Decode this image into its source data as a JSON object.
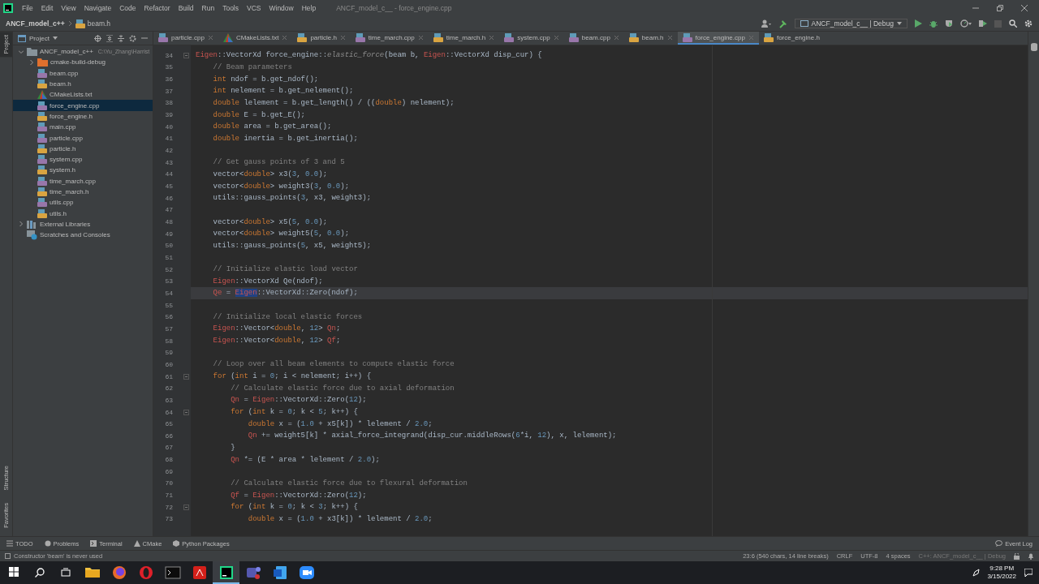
{
  "menu": [
    "File",
    "Edit",
    "View",
    "Navigate",
    "Code",
    "Refactor",
    "Build",
    "Run",
    "Tools",
    "VCS",
    "Window",
    "Help"
  ],
  "window": {
    "title": "ANCF_model_c__ - force_engine.cpp"
  },
  "breadcrumb": [
    "ANCF_model_c++",
    "beam.h"
  ],
  "run_config": "ANCF_model_c__ | Debug",
  "side_tools": {
    "top": [
      "Project"
    ],
    "bottom": [
      "Structure",
      "Favorites"
    ]
  },
  "project": {
    "title": "Project",
    "tree": [
      {
        "label": "ANCF_model_c++",
        "path": "C:\\Yu_Zhang\\Harrist",
        "kind": "module",
        "expanded": true,
        "selected": false,
        "children": [
          {
            "label": "cmake-build-debug",
            "kind": "folder",
            "expanded": false,
            "selected": false
          },
          {
            "label": "beam.cpp",
            "kind": "cpp",
            "selected": false
          },
          {
            "label": "beam.h",
            "kind": "h",
            "selected": false
          },
          {
            "label": "CMakeLists.txt",
            "kind": "cmake",
            "selected": false
          },
          {
            "label": "force_engine.cpp",
            "kind": "cpp",
            "selected": true
          },
          {
            "label": "force_engine.h",
            "kind": "h",
            "selected": false
          },
          {
            "label": "main.cpp",
            "kind": "cpp",
            "selected": false
          },
          {
            "label": "particle.cpp",
            "kind": "cpp",
            "selected": false
          },
          {
            "label": "particle.h",
            "kind": "h",
            "selected": false
          },
          {
            "label": "system.cpp",
            "kind": "cpp",
            "selected": false
          },
          {
            "label": "system.h",
            "kind": "h",
            "selected": false
          },
          {
            "label": "time_march.cpp",
            "kind": "cpp",
            "selected": false
          },
          {
            "label": "time_march.h",
            "kind": "h",
            "selected": false
          },
          {
            "label": "utils.cpp",
            "kind": "cpp",
            "selected": false
          },
          {
            "label": "utils.h",
            "kind": "h",
            "selected": false
          }
        ]
      },
      {
        "label": "External Libraries",
        "kind": "libs",
        "expanded": false,
        "selected": false
      },
      {
        "label": "Scratches and Consoles",
        "kind": "scratches",
        "selected": false
      }
    ]
  },
  "tabs": [
    {
      "label": "particle.cpp",
      "kind": "cpp",
      "selected": false,
      "closable": true
    },
    {
      "label": "CMakeLists.txt",
      "kind": "cmake",
      "selected": false,
      "closable": true
    },
    {
      "label": "particle.h",
      "kind": "h",
      "selected": false,
      "closable": true
    },
    {
      "label": "time_march.cpp",
      "kind": "cpp",
      "selected": false,
      "closable": true
    },
    {
      "label": "time_march.h",
      "kind": "h",
      "selected": false,
      "closable": true
    },
    {
      "label": "system.cpp",
      "kind": "cpp",
      "selected": false,
      "closable": true
    },
    {
      "label": "beam.cpp",
      "kind": "cpp",
      "selected": false,
      "closable": true
    },
    {
      "label": "beam.h",
      "kind": "h",
      "selected": false,
      "closable": true
    },
    {
      "label": "force_engine.cpp",
      "kind": "cpp",
      "selected": true,
      "closable": true
    },
    {
      "label": "force_engine.h",
      "kind": "h",
      "selected": false,
      "closable": false
    }
  ],
  "code": {
    "lines": [
      {
        "number": "34",
        "current": false,
        "segments": [
          {
            "kind": "red",
            "text": "Eigen"
          },
          {
            "kind": "plain",
            "text": "::VectorXd force_engine::"
          },
          {
            "kind": "decl",
            "text": "elastic_force"
          },
          {
            "kind": "plain",
            "text": "(beam b, "
          },
          {
            "kind": "red",
            "text": "Eigen"
          },
          {
            "kind": "plain",
            "text": "::VectorXd disp_cur) {"
          }
        ],
        "children": [
          {
            "number": "35",
            "current": false,
            "segments": [
              {
                "kind": "comment",
                "text": "// Beam parameters"
              }
            ]
          },
          {
            "number": "36",
            "current": false,
            "segments": [
              {
                "kind": "keyword",
                "text": "int"
              },
              {
                "kind": "plain",
                "text": " ndof = b.get_ndof();"
              }
            ]
          },
          {
            "number": "37",
            "current": false,
            "segments": [
              {
                "kind": "keyword",
                "text": "int"
              },
              {
                "kind": "plain",
                "text": " nelement = b.get_nelement();"
              }
            ]
          },
          {
            "number": "38",
            "current": false,
            "segments": [
              {
                "kind": "keyword",
                "text": "double"
              },
              {
                "kind": "plain",
                "text": " lelement = b.get_length() / (("
              },
              {
                "kind": "keyword",
                "text": "double"
              },
              {
                "kind": "plain",
                "text": ") nelement);"
              }
            ]
          },
          {
            "number": "39",
            "current": false,
            "segments": [
              {
                "kind": "keyword",
                "text": "double"
              },
              {
                "kind": "plain",
                "text": " E = b.get_E();"
              }
            ]
          },
          {
            "number": "40",
            "current": false,
            "segments": [
              {
                "kind": "keyword",
                "text": "double"
              },
              {
                "kind": "plain",
                "text": " area = b.get_area();"
              }
            ]
          },
          {
            "number": "41",
            "current": false,
            "segments": [
              {
                "kind": "keyword",
                "text": "double"
              },
              {
                "kind": "plain",
                "text": " inertia = b.get_inertia();"
              }
            ]
          },
          {
            "number": "42",
            "current": false
          },
          {
            "number": "43",
            "current": false,
            "segments": [
              {
                "kind": "comment",
                "text": "// Get gauss points of 3 and 5"
              }
            ]
          },
          {
            "number": "44",
            "current": false,
            "segments": [
              {
                "kind": "plain",
                "text": "vector<"
              },
              {
                "kind": "keyword",
                "text": "double"
              },
              {
                "kind": "plain",
                "text": "> x3("
              },
              {
                "kind": "number",
                "text": "3"
              },
              {
                "kind": "plain",
                "text": ", "
              },
              {
                "kind": "number",
                "text": "0.0"
              },
              {
                "kind": "plain",
                "text": ");"
              }
            ]
          },
          {
            "number": "45",
            "current": false,
            "segments": [
              {
                "kind": "plain",
                "text": "vector<"
              },
              {
                "kind": "keyword",
                "text": "double"
              },
              {
                "kind": "plain",
                "text": "> weight3("
              },
              {
                "kind": "number",
                "text": "3"
              },
              {
                "kind": "plain",
                "text": ", "
              },
              {
                "kind": "number",
                "text": "0.0"
              },
              {
                "kind": "plain",
                "text": ");"
              }
            ]
          },
          {
            "number": "46",
            "current": false,
            "segments": [
              {
                "kind": "plain",
                "text": "utils::gauss_points("
              },
              {
                "kind": "number",
                "text": "3"
              },
              {
                "kind": "plain",
                "text": ", x3, weight3);"
              }
            ]
          },
          {
            "number": "47",
            "current": false
          },
          {
            "number": "48",
            "current": false,
            "segments": [
              {
                "kind": "plain",
                "text": "vector<"
              },
              {
                "kind": "keyword",
                "text": "double"
              },
              {
                "kind": "plain",
                "text": "> x5("
              },
              {
                "kind": "number",
                "text": "5"
              },
              {
                "kind": "plain",
                "text": ", "
              },
              {
                "kind": "number",
                "text": "0.0"
              },
              {
                "kind": "plain",
                "text": ");"
              }
            ]
          },
          {
            "number": "49",
            "current": false,
            "segments": [
              {
                "kind": "plain",
                "text": "vector<"
              },
              {
                "kind": "keyword",
                "text": "double"
              },
              {
                "kind": "plain",
                "text": "> weight5("
              },
              {
                "kind": "number",
                "text": "5"
              },
              {
                "kind": "plain",
                "text": ", "
              },
              {
                "kind": "number",
                "text": "0.0"
              },
              {
                "kind": "plain",
                "text": ");"
              }
            ]
          },
          {
            "number": "50",
            "current": false,
            "segments": [
              {
                "kind": "plain",
                "text": "utils::gauss_points("
              },
              {
                "kind": "number",
                "text": "5"
              },
              {
                "kind": "plain",
                "text": ", x5, weight5);"
              }
            ]
          },
          {
            "number": "51",
            "current": false
          },
          {
            "number": "52",
            "current": false,
            "segments": [
              {
                "kind": "comment",
                "text": "// Initialize elastic load vector"
              }
            ]
          },
          {
            "number": "53",
            "current": false,
            "segments": [
              {
                "kind": "red",
                "text": "Eigen"
              },
              {
                "kind": "plain",
                "text": "::VectorXd Qe(ndof);"
              }
            ]
          },
          {
            "number": "54",
            "current": true,
            "segments": [
              {
                "kind": "red",
                "text": "Qe"
              },
              {
                "kind": "plain",
                "text": " = "
              },
              {
                "kind": "selection",
                "text": "Eigen"
              },
              {
                "kind": "plain",
                "text": "::VectorXd::Zero(ndof);"
              }
            ]
          },
          {
            "number": "55",
            "current": false
          },
          {
            "number": "56",
            "current": false,
            "segments": [
              {
                "kind": "comment",
                "text": "// Initialize local elastic forces"
              }
            ]
          },
          {
            "number": "57",
            "current": false,
            "segments": [
              {
                "kind": "red",
                "text": "Eigen"
              },
              {
                "kind": "plain",
                "text": "::Vector<"
              },
              {
                "kind": "keyword",
                "text": "double"
              },
              {
                "kind": "plain",
                "text": ", "
              },
              {
                "kind": "number",
                "text": "12"
              },
              {
                "kind": "plain",
                "text": "> "
              },
              {
                "kind": "red",
                "text": "Qn"
              },
              {
                "kind": "plain",
                "text": ";"
              }
            ]
          },
          {
            "number": "58",
            "current": false,
            "segments": [
              {
                "kind": "red",
                "text": "Eigen"
              },
              {
                "kind": "plain",
                "text": "::Vector<"
              },
              {
                "kind": "keyword",
                "text": "double"
              },
              {
                "kind": "plain",
                "text": ", "
              },
              {
                "kind": "number",
                "text": "12"
              },
              {
                "kind": "plain",
                "text": "> "
              },
              {
                "kind": "red",
                "text": "Qf"
              },
              {
                "kind": "plain",
                "text": ";"
              }
            ]
          },
          {
            "number": "59",
            "current": false
          },
          {
            "number": "60",
            "current": false,
            "segments": [
              {
                "kind": "comment",
                "text": "// Loop over all beam elements to compute elastic force"
              }
            ]
          },
          {
            "number": "61",
            "current": false,
            "segments": [
              {
                "kind": "keyword",
                "text": "for"
              },
              {
                "kind": "plain",
                "text": " ("
              },
              {
                "kind": "keyword",
                "text": "int"
              },
              {
                "kind": "plain",
                "text": " i = "
              },
              {
                "kind": "number",
                "text": "0"
              },
              {
                "kind": "plain",
                "text": "; i < nelement; i++) {"
              }
            ],
            "children": [
              {
                "number": "62",
                "current": false,
                "segments": [
                  {
                    "kind": "comment",
                    "text": "// Calculate elastic force due to axial deformation"
                  }
                ]
              },
              {
                "number": "63",
                "current": false,
                "segments": [
                  {
                    "kind": "red",
                    "text": "Qn"
                  },
                  {
                    "kind": "plain",
                    "text": " = "
                  },
                  {
                    "kind": "red",
                    "text": "Eigen"
                  },
                  {
                    "kind": "plain",
                    "text": "::VectorXd::Zero("
                  },
                  {
                    "kind": "number",
                    "text": "12"
                  },
                  {
                    "kind": "plain",
                    "text": ");"
                  }
                ]
              },
              {
                "number": "64",
                "current": false,
                "segments": [
                  {
                    "kind": "keyword",
                    "text": "for"
                  },
                  {
                    "kind": "plain",
                    "text": " ("
                  },
                  {
                    "kind": "keyword",
                    "text": "int"
                  },
                  {
                    "kind": "plain",
                    "text": " k = "
                  },
                  {
                    "kind": "number",
                    "text": "0"
                  },
                  {
                    "kind": "plain",
                    "text": "; k < "
                  },
                  {
                    "kind": "number",
                    "text": "5"
                  },
                  {
                    "kind": "plain",
                    "text": "; k++) {"
                  }
                ],
                "children": [
                  {
                    "number": "65",
                    "current": false,
                    "segments": [
                      {
                        "kind": "keyword",
                        "text": "double"
                      },
                      {
                        "kind": "plain",
                        "text": " x = ("
                      },
                      {
                        "kind": "number",
                        "text": "1.0"
                      },
                      {
                        "kind": "plain",
                        "text": " + x5[k]) * lelement / "
                      },
                      {
                        "kind": "number",
                        "text": "2.0"
                      },
                      {
                        "kind": "plain",
                        "text": ";"
                      }
                    ]
                  },
                  {
                    "number": "66",
                    "current": false,
                    "segments": [
                      {
                        "kind": "red",
                        "text": "Qn"
                      },
                      {
                        "kind": "plain",
                        "text": " += weight5[k] * axial_force_integrand(disp_cur.middleRows("
                      },
                      {
                        "kind": "number",
                        "text": "6"
                      },
                      {
                        "kind": "plain",
                        "text": "*i, "
                      },
                      {
                        "kind": "number",
                        "text": "12"
                      },
                      {
                        "kind": "plain",
                        "text": "), x, lelement);"
                      }
                    ]
                  }
                ]
              },
              {
                "number": "67",
                "current": false,
                "segments": [
                  {
                    "kind": "plain",
                    "text": "}"
                  }
                ]
              },
              {
                "number": "68",
                "current": false,
                "segments": [
                  {
                    "kind": "red",
                    "text": "Qn"
                  },
                  {
                    "kind": "plain",
                    "text": " *= (E * area * lelement / "
                  },
                  {
                    "kind": "number",
                    "text": "2.0"
                  },
                  {
                    "kind": "plain",
                    "text": ");"
                  }
                ]
              },
              {
                "number": "69",
                "current": false
              },
              {
                "number": "70",
                "current": false,
                "segments": [
                  {
                    "kind": "comment",
                    "text": "// Calculate elastic force due to flexural deformation"
                  }
                ]
              },
              {
                "number": "71",
                "current": false,
                "segments": [
                  {
                    "kind": "red",
                    "text": "Qf"
                  },
                  {
                    "kind": "plain",
                    "text": " = "
                  },
                  {
                    "kind": "red",
                    "text": "Eigen"
                  },
                  {
                    "kind": "plain",
                    "text": "::VectorXd::Zero("
                  },
                  {
                    "kind": "number",
                    "text": "12"
                  },
                  {
                    "kind": "plain",
                    "text": ");"
                  }
                ]
              },
              {
                "number": "72",
                "current": false,
                "segments": [
                  {
                    "kind": "keyword",
                    "text": "for"
                  },
                  {
                    "kind": "plain",
                    "text": " ("
                  },
                  {
                    "kind": "keyword",
                    "text": "int"
                  },
                  {
                    "kind": "plain",
                    "text": " k = "
                  },
                  {
                    "kind": "number",
                    "text": "0"
                  },
                  {
                    "kind": "plain",
                    "text": "; k < "
                  },
                  {
                    "kind": "number",
                    "text": "3"
                  },
                  {
                    "kind": "plain",
                    "text": "; k++) {"
                  }
                ],
                "children": [
                  {
                    "number": "73",
                    "current": false,
                    "segments": [
                      {
                        "kind": "keyword",
                        "text": "double"
                      },
                      {
                        "kind": "plain",
                        "text": " x = ("
                      },
                      {
                        "kind": "number",
                        "text": "1.0"
                      },
                      {
                        "kind": "plain",
                        "text": " + x3[k]) * lelement / "
                      },
                      {
                        "kind": "number",
                        "text": "2.0"
                      },
                      {
                        "kind": "plain",
                        "text": ";"
                      }
                    ]
                  }
                ]
              }
            ]
          }
        ]
      }
    ]
  },
  "tool_tabs": [
    {
      "label": "TODO",
      "kind": "todo"
    },
    {
      "label": "Problems",
      "kind": "problems"
    },
    {
      "label": "Terminal",
      "kind": "terminal"
    },
    {
      "label": "CMake",
      "kind": "cmake"
    },
    {
      "label": "Python Packages",
      "kind": "packages"
    }
  ],
  "event_log": "Event Log",
  "status_bar": {
    "message": "Constructor 'beam' is never used",
    "items": [
      "23:6 (540 chars, 14 line breaks)",
      "CRLF",
      "UTF-8",
      "4 spaces",
      "C++: ANCF_model_c__ | Debug"
    ]
  },
  "taskbar": {
    "apps": [
      {
        "kind": "explorer",
        "selected": false
      },
      {
        "kind": "firefox",
        "selected": false
      },
      {
        "kind": "opera",
        "selected": false
      },
      {
        "kind": "terminal",
        "selected": false
      },
      {
        "kind": "acrobat",
        "selected": false
      },
      {
        "kind": "clion",
        "selected": true
      },
      {
        "kind": "teams",
        "selected": false
      },
      {
        "kind": "word",
        "selected": false
      },
      {
        "kind": "zoom",
        "selected": false
      }
    ],
    "time": "9:28 PM",
    "date": "3/15/2022"
  }
}
